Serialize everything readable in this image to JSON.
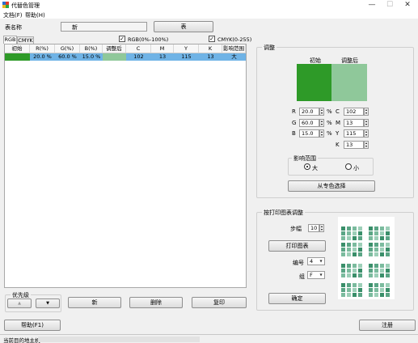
{
  "window": {
    "title": "代替色管理",
    "min": "—",
    "max": "☐",
    "close": "✕"
  },
  "menu": {
    "file": "文档(F)",
    "help": "帮助(H)"
  },
  "form": {
    "name_label": "表名称",
    "name_value": "新",
    "table_button": "表"
  },
  "tabs": {
    "rgb": "RGB",
    "cmyk": "CMYK"
  },
  "checks": {
    "rgb_label": "RGB(0%-100%)",
    "cmyk_label": "CMYK(0-255)"
  },
  "table": {
    "headers": [
      "初始",
      "R(%)",
      "G(%)",
      "B(%)",
      "调整后",
      "C",
      "M",
      "Y",
      "K",
      "影响范围"
    ],
    "row": {
      "r": "20.0 %",
      "g": "60.0 %",
      "b": "15.0 %",
      "c": "102",
      "m": "13",
      "y": "115",
      "k": "13",
      "range": "大"
    }
  },
  "priority": {
    "title": "优先级",
    "up": "▲",
    "down": "▼"
  },
  "actions": {
    "new": "新",
    "delete": "删除",
    "print": "复印"
  },
  "adjust": {
    "title": "调整",
    "initial_label": "初始",
    "adjusted_label": "调整后",
    "initial_color": "#2e9a28",
    "adjusted_color": "#8fc89a",
    "r_label": "R",
    "g_label": "G",
    "b_label": "B",
    "r_value": "20.0",
    "g_value": "60.0",
    "b_value": "15.0",
    "pct": "%",
    "c_label": "C",
    "m_label": "M",
    "y_label": "Y",
    "k_label": "K",
    "c_value": "102",
    "m_value": "13",
    "y_value": "115",
    "k_value": "13",
    "range_title": "影响范围",
    "large": "大",
    "small": "小",
    "select_button": "从专色选择"
  },
  "print_adjust": {
    "title": "按打印图表调整",
    "step_label": "步幅",
    "step_value": "10",
    "print_chart_button": "打印图表",
    "number_label": "编号",
    "number_value": "4",
    "group_label": "组",
    "group_value": "F",
    "ok_button": "确定"
  },
  "bottom": {
    "help_button": "帮助(F1)",
    "register_button": "注册"
  },
  "status": {
    "text": "当前目的地主机"
  }
}
